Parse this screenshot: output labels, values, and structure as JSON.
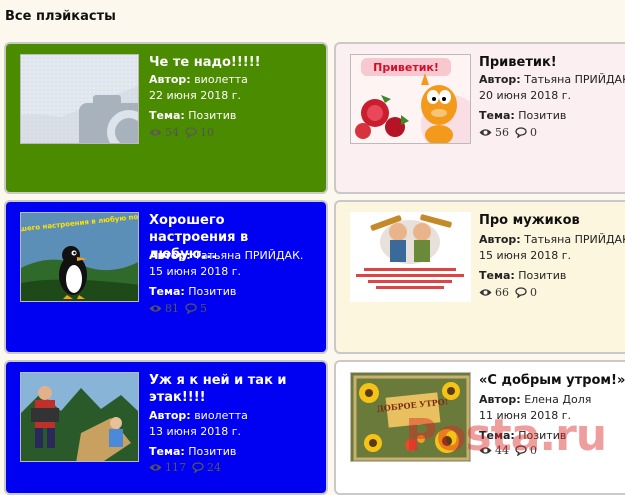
{
  "page": {
    "heading": "Все плэйкасты"
  },
  "labels": {
    "author": "Автор:",
    "theme": "Тема:"
  },
  "cards": [
    {
      "title": "Че те надо!!!!!",
      "author": "виолетта",
      "date": "22 июня 2018 г.",
      "theme": "Позитив",
      "views": "54",
      "comments": "10",
      "bg": "#4b8b00"
    },
    {
      "title": "Приветик!",
      "author": "Татьяна ПРИЙДАК.",
      "date": "20 июня 2018 г.",
      "theme": "Позитив",
      "views": "56",
      "comments": "0",
      "bg": "#fbeff1",
      "image_text": "Приветик!"
    },
    {
      "title": "Хорошего настроения в любую...",
      "author": "Татьяна ПРИЙДАК.",
      "date": "15 июня 2018 г.",
      "theme": "Позитив",
      "views": "81",
      "comments": "5",
      "bg": "#0000f2",
      "image_text": "Хорошего настроения в любую погоду!"
    },
    {
      "title": "Про мужиков",
      "author": "Татьяна ПРИЙДАК.",
      "date": "15 июня 2018 г.",
      "theme": "Позитив",
      "views": "66",
      "comments": "0",
      "bg": "#fdf6df"
    },
    {
      "title": "Уж я к ней и так и этак!!!!",
      "author": "виолетта",
      "date": "13 июня 2018 г.",
      "theme": "Позитив",
      "views": "117",
      "comments": "24",
      "bg": "#0000f2"
    },
    {
      "title": "«С добрым утром!»",
      "author": "Елена Доля",
      "date": "11 июня 2018 г.",
      "theme": "Позитив",
      "views": "44",
      "comments": "0",
      "bg": "#ffffff",
      "image_text": "ДОБРОЕ УТРО!"
    }
  ],
  "watermark": {
    "text": "Posta.ru"
  },
  "icons": {
    "views": "eye-icon",
    "comments": "speech-bubble-icon",
    "placeholder": "camera-placeholder-icon"
  }
}
